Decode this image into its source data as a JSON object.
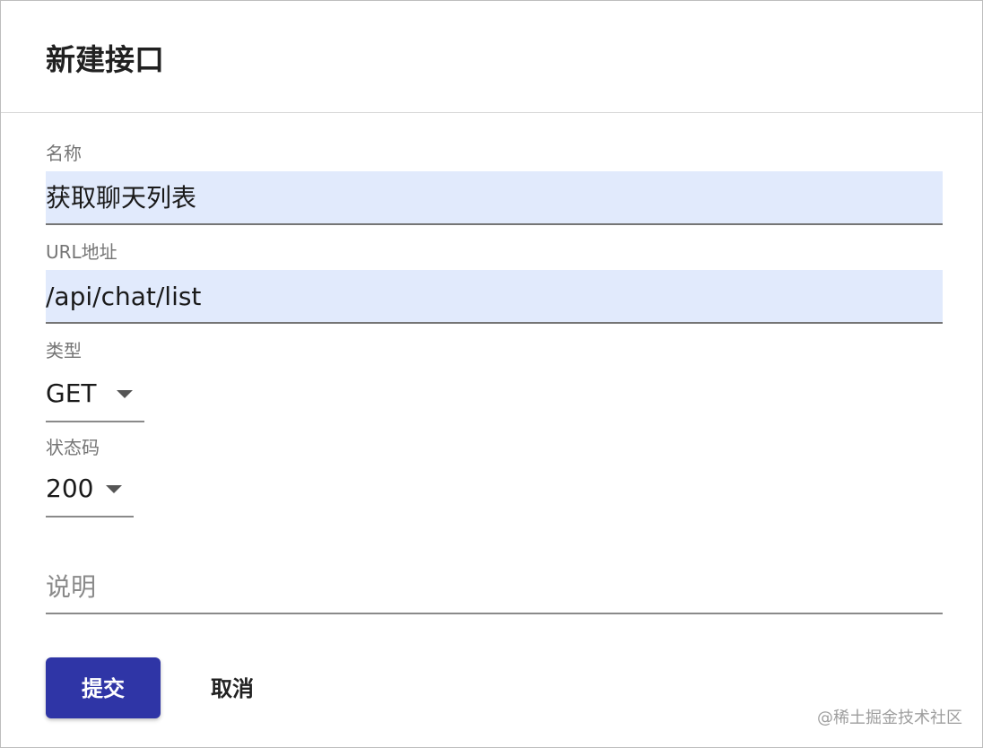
{
  "dialog": {
    "title": "新建接口"
  },
  "form": {
    "name": {
      "label": "名称",
      "value": "获取聊天列表"
    },
    "url": {
      "label": "URL地址",
      "value": "/api/chat/list"
    },
    "type": {
      "label": "类型",
      "selected": "GET"
    },
    "status_code": {
      "label": "状态码",
      "selected": "200"
    },
    "description": {
      "placeholder": "说明",
      "value": ""
    }
  },
  "actions": {
    "submit_label": "提交",
    "cancel_label": "取消"
  },
  "watermark": {
    "text": "@稀土掘金技术社区"
  },
  "colors": {
    "primary": "#2f35a6",
    "input_fill": "#e1eafc",
    "label": "#757575"
  },
  "icons": {
    "dropdown": "caret-down-icon"
  }
}
